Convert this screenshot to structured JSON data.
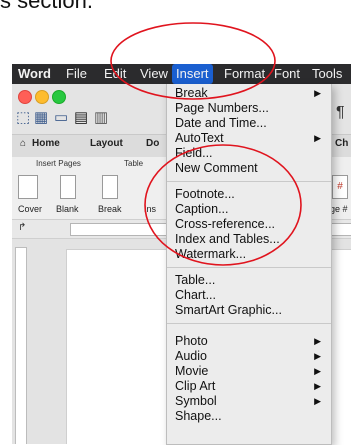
{
  "caption_fragment": "s section.",
  "menubar": {
    "app": "Word",
    "items": [
      "File",
      "Edit",
      "View",
      "Insert",
      "Format",
      "Font",
      "Tools"
    ],
    "active": "Insert"
  },
  "ribbon": {
    "tabs": [
      "Home",
      "Layout",
      "Do",
      "Ch"
    ],
    "groups": [
      "Insert Pages",
      "Table"
    ],
    "buttons": [
      "Cover",
      "Blank",
      "Break",
      "Ins",
      "ge #"
    ]
  },
  "insert_menu": {
    "group1": [
      {
        "label": "Break",
        "submenu": true
      },
      {
        "label": "Page Numbers...",
        "submenu": false
      },
      {
        "label": "Date and Time...",
        "submenu": false
      },
      {
        "label": "AutoText",
        "submenu": true
      },
      {
        "label": "Field...",
        "submenu": false
      },
      {
        "label": "New Comment",
        "submenu": false
      }
    ],
    "group2": [
      {
        "label": "Footnote...",
        "submenu": false
      },
      {
        "label": "Caption...",
        "submenu": false
      },
      {
        "label": "Cross-reference...",
        "submenu": false
      },
      {
        "label": "Index and Tables...",
        "submenu": false
      },
      {
        "label": "Watermark...",
        "submenu": false
      }
    ],
    "group3": [
      {
        "label": "Table...",
        "submenu": false
      },
      {
        "label": "Chart...",
        "submenu": false
      },
      {
        "label": "SmartArt Graphic...",
        "submenu": false
      }
    ],
    "group4": [
      {
        "label": "Photo",
        "submenu": true
      },
      {
        "label": "Audio",
        "submenu": true
      },
      {
        "label": "Movie",
        "submenu": true
      },
      {
        "label": "Clip Art",
        "submenu": true
      },
      {
        "label": "Symbol",
        "submenu": true
      },
      {
        "label": "Shape...",
        "submenu": false
      }
    ]
  },
  "colors": {
    "menubar_bg": "#2b2b2d",
    "active_menu": "#1a5fd0",
    "annotation_red": "#e0141e"
  }
}
